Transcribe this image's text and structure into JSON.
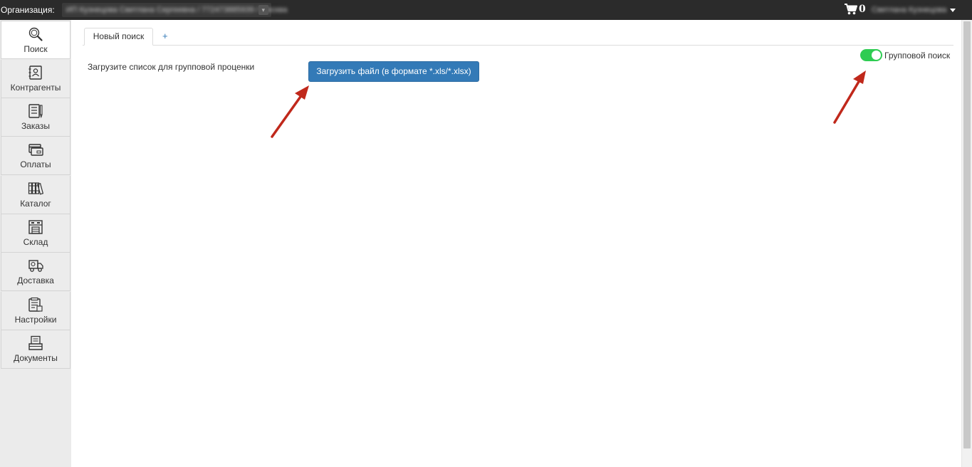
{
  "topbar": {
    "org_label": "Организация:",
    "org_value": "ИП Кузнецова Светлана Сергеевна / 772473885939 / Москва",
    "cart_count": "0",
    "user_name": "Светлана Кузнецова"
  },
  "sidebar": {
    "items": [
      {
        "label": "Поиск",
        "icon": "search-icon",
        "active": true
      },
      {
        "label": "Контрагенты",
        "icon": "contacts-icon"
      },
      {
        "label": "Заказы",
        "icon": "orders-icon"
      },
      {
        "label": "Оплаты",
        "icon": "payments-icon"
      },
      {
        "label": "Каталог",
        "icon": "catalog-icon"
      },
      {
        "label": "Склад",
        "icon": "warehouse-icon"
      },
      {
        "label": "Доставка",
        "icon": "delivery-icon"
      },
      {
        "label": "Настройки",
        "icon": "settings-icon"
      },
      {
        "label": "Документы",
        "icon": "documents-icon"
      }
    ]
  },
  "tabs": {
    "items": [
      {
        "label": "Новый поиск"
      }
    ],
    "add_label": "+"
  },
  "main": {
    "upload_label": "Загрузите список для групповой проценки",
    "upload_button": "Загрузить файл (в формате *.xls/*.xlsx)",
    "group_toggle_label": "Групповой поиск",
    "group_toggle_on": true
  },
  "colors": {
    "topbar": "#2b2b2b",
    "primary": "#337ab7",
    "toggle_on": "#2ecc52",
    "annotation_arrow": "#c0281b"
  }
}
